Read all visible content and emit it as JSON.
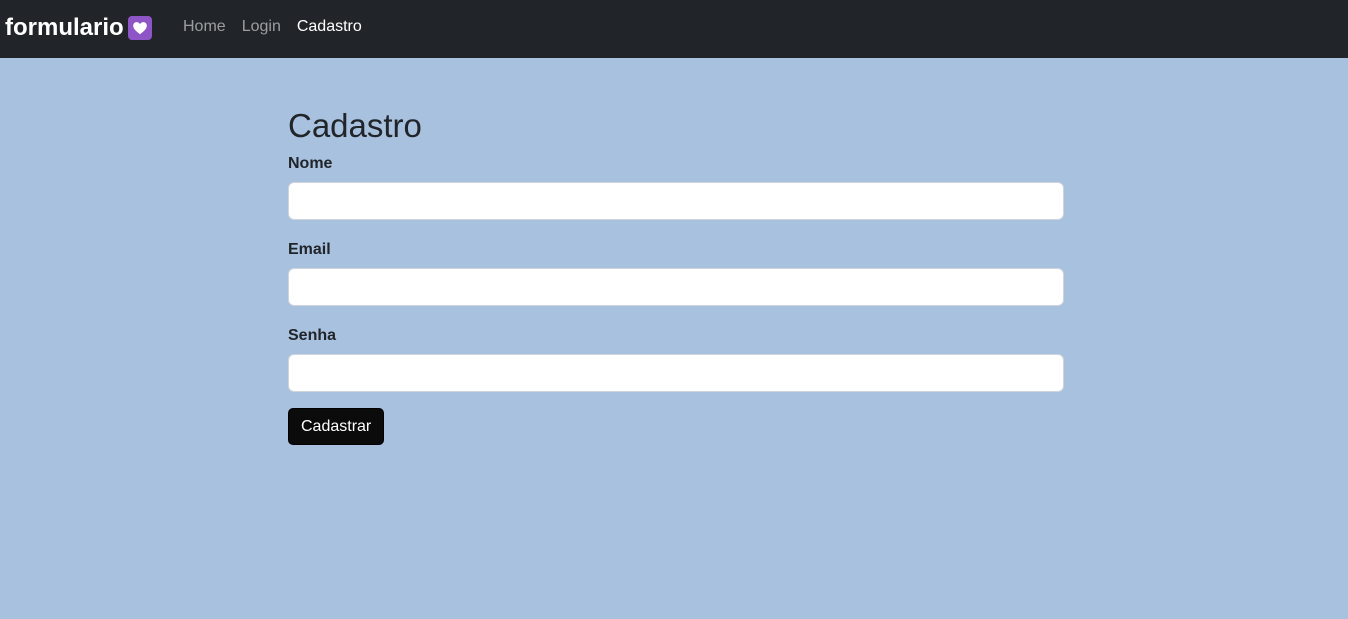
{
  "navbar": {
    "brand": "formulario",
    "brand_icon": "heart-icon",
    "brand_icon_bg": "#8e55c7",
    "links": [
      {
        "label": "Home",
        "active": false
      },
      {
        "label": "Login",
        "active": false
      },
      {
        "label": "Cadastro",
        "active": true
      }
    ]
  },
  "form": {
    "title": "Cadastro",
    "fields": [
      {
        "label": "Nome",
        "value": "",
        "placeholder": ""
      },
      {
        "label": "Email",
        "value": "",
        "placeholder": ""
      },
      {
        "label": "Senha",
        "value": "",
        "placeholder": ""
      }
    ],
    "submit_label": "Cadastrar"
  },
  "colors": {
    "navbar_bg": "#212529",
    "page_bg": "#a7c1df",
    "button_bg": "#0b0b0b"
  }
}
